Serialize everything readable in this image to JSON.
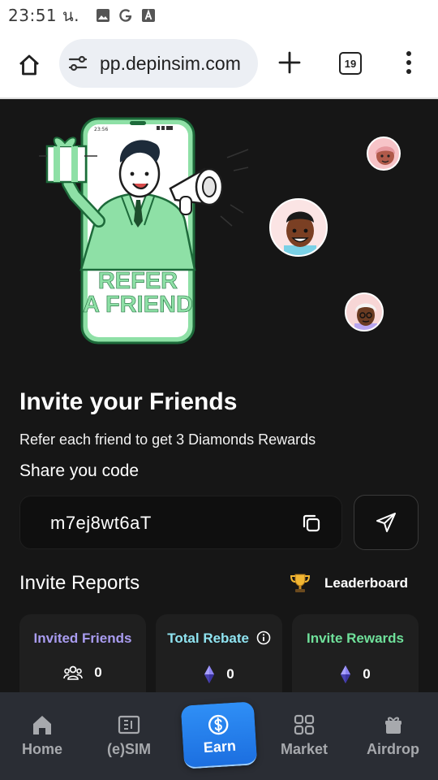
{
  "status_bar": {
    "time": "23:51",
    "period": "น.",
    "icons": [
      "gallery-icon",
      "google-icon",
      "translate-icon"
    ]
  },
  "browser": {
    "url": "pp.depinsim.com",
    "tab_count": "19",
    "icons": [
      "home-icon",
      "site-settings-icon",
      "new-tab-icon",
      "tab-switcher-icon",
      "overflow-menu-icon"
    ]
  },
  "hero": {
    "phone_time": "23:56",
    "banner_line1": "REFER",
    "banner_line2": "A FRIEND"
  },
  "invite": {
    "title": "Invite your Friends",
    "subtitle": "Refer each friend to get 3 Diamonds Rewards",
    "share_label": "Share you code",
    "code": "m7ej8wt6aT"
  },
  "reports": {
    "title": "Invite Reports",
    "leaderboard_label": "Leaderboard",
    "stats": [
      {
        "label": "Invited Friends",
        "value": "0",
        "color": "#a99cf0",
        "icon": "people-icon"
      },
      {
        "label": "Total Rebate",
        "value": "0",
        "color": "#8fe3f0",
        "icon": "diamond-icon"
      },
      {
        "label": "Invite Rewards",
        "value": "0",
        "color": "#6fe09a",
        "icon": "diamond-icon"
      }
    ]
  },
  "nav": {
    "items": [
      {
        "label": "Home",
        "icon": "home-icon"
      },
      {
        "label": "(e)SIM",
        "icon": "sim-icon"
      },
      {
        "label": "Earn",
        "icon": "dollar-coin-icon"
      },
      {
        "label": "Market",
        "icon": "grid-icon"
      },
      {
        "label": "Airdrop",
        "icon": "gift-icon"
      }
    ]
  },
  "colors": {
    "background": "#161616",
    "accent_blue": "#2a88f2",
    "nav_bg": "#2a2d34",
    "illustration_green": "#8ee0a6",
    "illustration_dark_green": "#1d6a3a"
  }
}
